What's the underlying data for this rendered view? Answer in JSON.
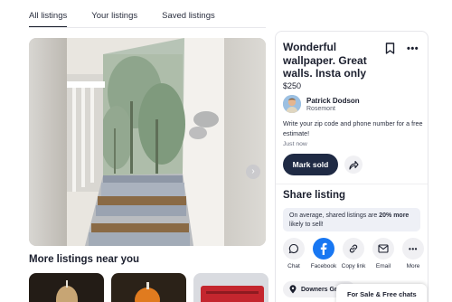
{
  "tabs": [
    {
      "label": "All listings",
      "active": true
    },
    {
      "label": "Your listings",
      "active": false
    },
    {
      "label": "Saved listings",
      "active": false
    }
  ],
  "gallery": {
    "next_icon": "chevron-right-icon"
  },
  "more_listings": {
    "title": "More listings near you"
  },
  "listing": {
    "title": "Wonderful wallpaper. Great walls. Insta only",
    "price": "$250",
    "seller_name": "Patrick Dodson",
    "seller_location": "Rosemont",
    "description": "Write your zip code and phone number for a free estimate!",
    "posted": "Just now",
    "mark_sold_label": "Mark sold"
  },
  "share": {
    "title": "Share listing",
    "tip_prefix": "On average, shared listings are ",
    "tip_bold": "20% more",
    "tip_suffix": " likely to sell!",
    "options": [
      {
        "label": "Chat",
        "icon": "chat-bubble-icon"
      },
      {
        "label": "Facebook",
        "icon": "facebook-icon"
      },
      {
        "label": "Copy link",
        "icon": "link-icon"
      },
      {
        "label": "Email",
        "icon": "email-icon"
      },
      {
        "label": "More",
        "icon": "more-dots-icon"
      }
    ]
  },
  "location_chip": "Downers Gr",
  "chats_bar": "For Sale & Free chats",
  "colors": {
    "primary_button": "#1f2a44",
    "facebook": "#1877f2"
  }
}
